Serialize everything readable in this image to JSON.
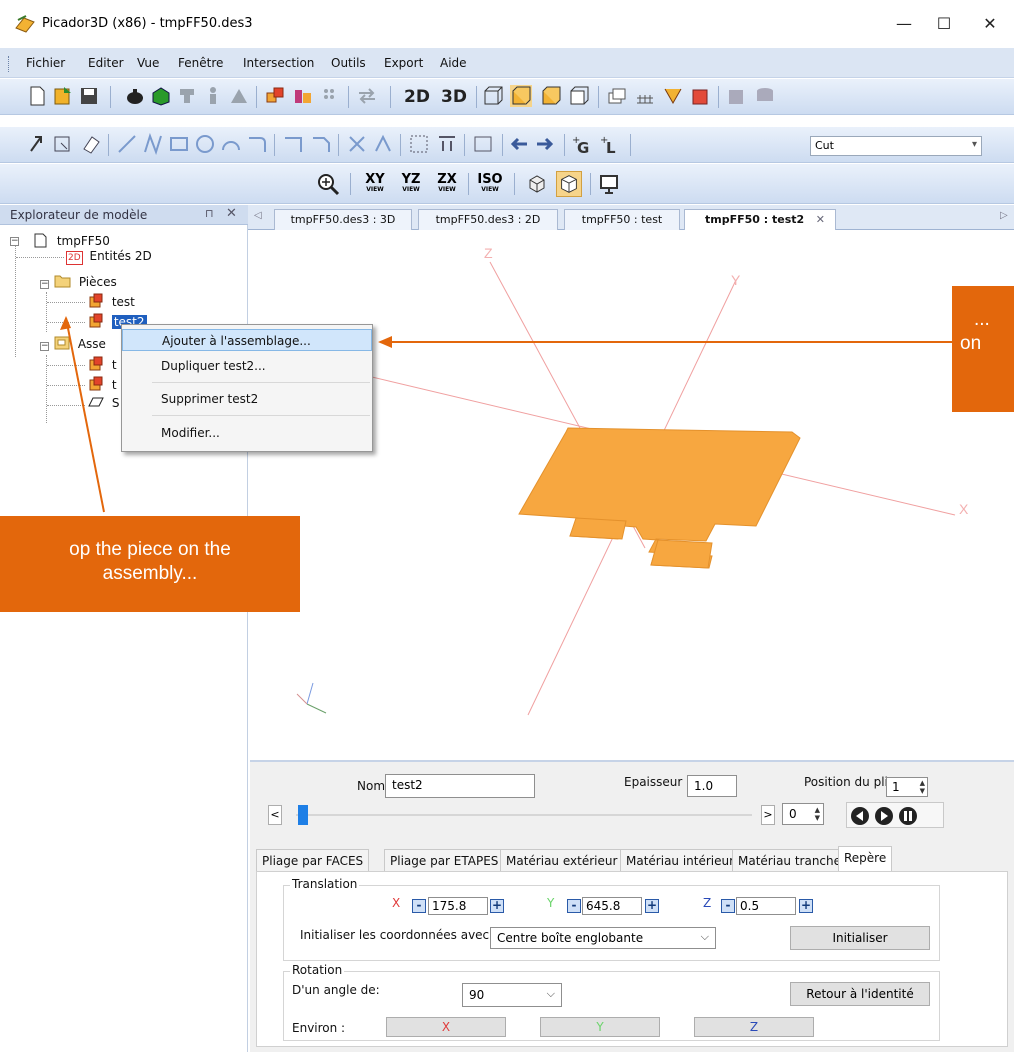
{
  "window": {
    "title": "Picador3D (x86) - tmpFF50.des3",
    "minimize": "—",
    "maximize": "☐",
    "close": "✕"
  },
  "menu": [
    "Fichier",
    "Editer",
    "Vue",
    "Fenêtre",
    "Intersection",
    "Outils",
    "Export",
    "Aide"
  ],
  "toolbar1": {
    "label_2d": "2D",
    "label_3d": "3D"
  },
  "toolbar2": {
    "cut_value": "Cut"
  },
  "toolbar3": {
    "views": [
      "XY",
      "YZ",
      "ZX",
      "ISO"
    ],
    "view_sub": "VIEW"
  },
  "explorer": {
    "title": "Explorateur de modèle",
    "pin": "⊓",
    "close": "✕",
    "tree": {
      "root": "tmpFF50",
      "entities": "Entités 2D",
      "entities_tag": "2D",
      "pieces": "Pièces",
      "piece1": "test",
      "piece2": "test2",
      "assembly": "Asse",
      "asm_child1": "t",
      "asm_child2": "t",
      "asm_child3": "S"
    }
  },
  "doc_tabs": [
    "tmpFF50.des3 : 3D",
    "tmpFF50.des3 : 2D",
    "tmpFF50 : test",
    "tmpFF50 : test2"
  ],
  "viewport": {
    "axis_x": "X",
    "axis_y": "Y",
    "axis_z": "Z"
  },
  "context_menu": [
    "Ajouter à l'assemblage...",
    "Dupliquer test2...",
    "Supprimer test2",
    "Modifier..."
  ],
  "bottom": {
    "nom_label": "Nom",
    "nom_value": "test2",
    "epaisseur_label": "Epaisseur",
    "epaisseur_value": "1.0",
    "position_label": "Position du pli",
    "position_value": "1",
    "slider_left": "<",
    "slider_right": ">",
    "step_value": "0",
    "tabs": [
      "Pliage par FACES",
      "Pliage par ETAPES",
      "Matériau extérieur",
      "Matériau intérieur",
      "Matériau tranche",
      "Repère"
    ],
    "translation": {
      "title": "Translation",
      "x_label": "X",
      "x_value": "175.8",
      "y_label": "Y",
      "y_value": "645.8",
      "z_label": "Z",
      "z_value": "0.5",
      "minus": "-",
      "plus": "+",
      "init_label": "Initialiser les coordonnées avec",
      "init_option": "Centre boîte englobante",
      "init_button": "Initialiser"
    },
    "rotation": {
      "title": "Rotation",
      "angle_label": "D'un angle de:",
      "angle_value": "90",
      "reset_button": "Retour à l'identité",
      "about_label": "Environ :",
      "axes": [
        "X",
        "Y",
        "Z"
      ]
    }
  },
  "annotations": {
    "left": [
      "op the piece on the",
      "assembly..."
    ],
    "right": [
      "...",
      "on"
    ]
  },
  "colors": {
    "accent": "#e3670c",
    "shape": "#f7a740",
    "axis": "#f0a0a0",
    "selection": "#1f5fbf"
  }
}
